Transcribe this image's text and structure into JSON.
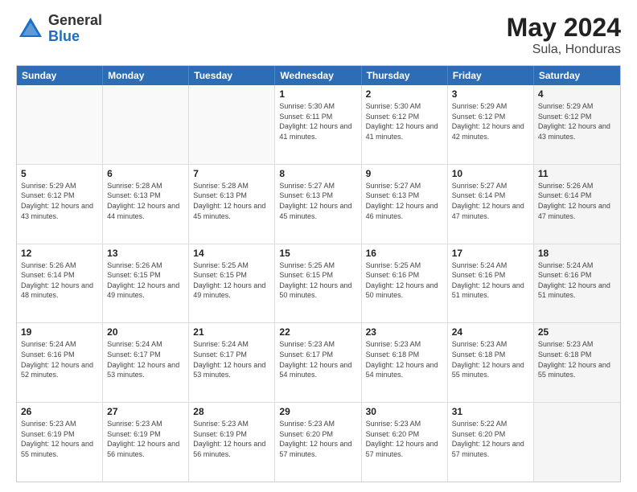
{
  "logo": {
    "general": "General",
    "blue": "Blue"
  },
  "title": "May 2024",
  "location": "Sula, Honduras",
  "weekdays": [
    "Sunday",
    "Monday",
    "Tuesday",
    "Wednesday",
    "Thursday",
    "Friday",
    "Saturday"
  ],
  "rows": [
    [
      {
        "day": "",
        "empty": true
      },
      {
        "day": "",
        "empty": true
      },
      {
        "day": "",
        "empty": true
      },
      {
        "day": "1",
        "sunrise": "5:30 AM",
        "sunset": "6:11 PM",
        "daylight": "12 hours and 41 minutes."
      },
      {
        "day": "2",
        "sunrise": "5:30 AM",
        "sunset": "6:12 PM",
        "daylight": "12 hours and 41 minutes."
      },
      {
        "day": "3",
        "sunrise": "5:29 AM",
        "sunset": "6:12 PM",
        "daylight": "12 hours and 42 minutes."
      },
      {
        "day": "4",
        "sunrise": "5:29 AM",
        "sunset": "6:12 PM",
        "daylight": "12 hours and 43 minutes.",
        "shaded": true
      }
    ],
    [
      {
        "day": "5",
        "sunrise": "5:29 AM",
        "sunset": "6:12 PM",
        "daylight": "12 hours and 43 minutes."
      },
      {
        "day": "6",
        "sunrise": "5:28 AM",
        "sunset": "6:13 PM",
        "daylight": "12 hours and 44 minutes."
      },
      {
        "day": "7",
        "sunrise": "5:28 AM",
        "sunset": "6:13 PM",
        "daylight": "12 hours and 45 minutes."
      },
      {
        "day": "8",
        "sunrise": "5:27 AM",
        "sunset": "6:13 PM",
        "daylight": "12 hours and 45 minutes."
      },
      {
        "day": "9",
        "sunrise": "5:27 AM",
        "sunset": "6:13 PM",
        "daylight": "12 hours and 46 minutes."
      },
      {
        "day": "10",
        "sunrise": "5:27 AM",
        "sunset": "6:14 PM",
        "daylight": "12 hours and 47 minutes."
      },
      {
        "day": "11",
        "sunrise": "5:26 AM",
        "sunset": "6:14 PM",
        "daylight": "12 hours and 47 minutes.",
        "shaded": true
      }
    ],
    [
      {
        "day": "12",
        "sunrise": "5:26 AM",
        "sunset": "6:14 PM",
        "daylight": "12 hours and 48 minutes."
      },
      {
        "day": "13",
        "sunrise": "5:26 AM",
        "sunset": "6:15 PM",
        "daylight": "12 hours and 49 minutes."
      },
      {
        "day": "14",
        "sunrise": "5:25 AM",
        "sunset": "6:15 PM",
        "daylight": "12 hours and 49 minutes."
      },
      {
        "day": "15",
        "sunrise": "5:25 AM",
        "sunset": "6:15 PM",
        "daylight": "12 hours and 50 minutes."
      },
      {
        "day": "16",
        "sunrise": "5:25 AM",
        "sunset": "6:16 PM",
        "daylight": "12 hours and 50 minutes."
      },
      {
        "day": "17",
        "sunrise": "5:24 AM",
        "sunset": "6:16 PM",
        "daylight": "12 hours and 51 minutes."
      },
      {
        "day": "18",
        "sunrise": "5:24 AM",
        "sunset": "6:16 PM",
        "daylight": "12 hours and 51 minutes.",
        "shaded": true
      }
    ],
    [
      {
        "day": "19",
        "sunrise": "5:24 AM",
        "sunset": "6:16 PM",
        "daylight": "12 hours and 52 minutes."
      },
      {
        "day": "20",
        "sunrise": "5:24 AM",
        "sunset": "6:17 PM",
        "daylight": "12 hours and 53 minutes."
      },
      {
        "day": "21",
        "sunrise": "5:24 AM",
        "sunset": "6:17 PM",
        "daylight": "12 hours and 53 minutes."
      },
      {
        "day": "22",
        "sunrise": "5:23 AM",
        "sunset": "6:17 PM",
        "daylight": "12 hours and 54 minutes."
      },
      {
        "day": "23",
        "sunrise": "5:23 AM",
        "sunset": "6:18 PM",
        "daylight": "12 hours and 54 minutes."
      },
      {
        "day": "24",
        "sunrise": "5:23 AM",
        "sunset": "6:18 PM",
        "daylight": "12 hours and 55 minutes."
      },
      {
        "day": "25",
        "sunrise": "5:23 AM",
        "sunset": "6:18 PM",
        "daylight": "12 hours and 55 minutes.",
        "shaded": true
      }
    ],
    [
      {
        "day": "26",
        "sunrise": "5:23 AM",
        "sunset": "6:19 PM",
        "daylight": "12 hours and 55 minutes."
      },
      {
        "day": "27",
        "sunrise": "5:23 AM",
        "sunset": "6:19 PM",
        "daylight": "12 hours and 56 minutes."
      },
      {
        "day": "28",
        "sunrise": "5:23 AM",
        "sunset": "6:19 PM",
        "daylight": "12 hours and 56 minutes."
      },
      {
        "day": "29",
        "sunrise": "5:23 AM",
        "sunset": "6:20 PM",
        "daylight": "12 hours and 57 minutes."
      },
      {
        "day": "30",
        "sunrise": "5:23 AM",
        "sunset": "6:20 PM",
        "daylight": "12 hours and 57 minutes."
      },
      {
        "day": "31",
        "sunrise": "5:22 AM",
        "sunset": "6:20 PM",
        "daylight": "12 hours and 57 minutes."
      },
      {
        "day": "",
        "empty": true,
        "shaded": true
      }
    ]
  ]
}
